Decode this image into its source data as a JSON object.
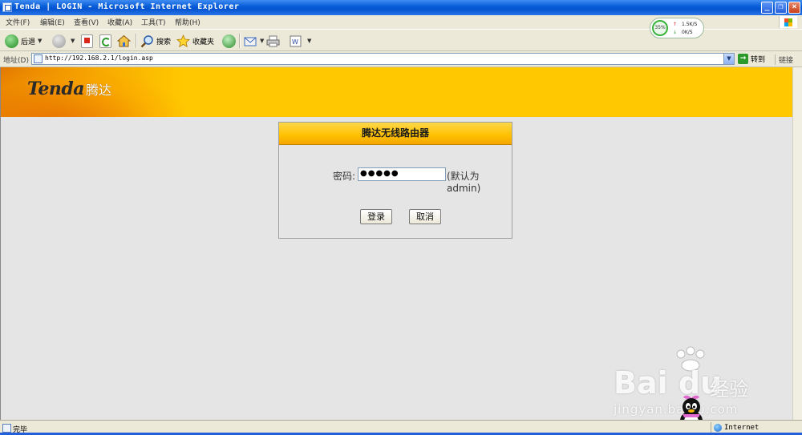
{
  "window": {
    "title": "Tenda | LOGIN - Microsoft Internet Explorer",
    "minimize": "_",
    "maximize": "❐",
    "close": "×"
  },
  "menubar": {
    "items": [
      {
        "label": "文件(F)"
      },
      {
        "label": "编辑(E)"
      },
      {
        "label": "查看(V)"
      },
      {
        "label": "收藏(A)"
      },
      {
        "label": "工具(T)"
      },
      {
        "label": "帮助(H)"
      }
    ]
  },
  "toolbar": {
    "back_label": "后退",
    "search_label": "搜索",
    "favorites_label": "收藏夹"
  },
  "speed_widget": {
    "cpu": "35%",
    "up": "1.5K/S",
    "down": "0K/S"
  },
  "addressbar": {
    "label": "地址(D)",
    "url": "http://192.168.2.1/login.asp",
    "go_label": "转到",
    "links_label": "链接"
  },
  "banner": {
    "logo_en": "Tenda",
    "logo_cn": "腾达"
  },
  "login": {
    "title": "腾达无线路由器",
    "password_label": "密码:",
    "password_value": "●●●●●",
    "password_hint": "(默认为admin)",
    "login_button": "登录",
    "cancel_button": "取消"
  },
  "watermark": {
    "brand": "Bai du",
    "brand_cn": "经验",
    "url": "jingyan.baidu.com"
  },
  "statusbar": {
    "status": "完毕",
    "zone": "Internet"
  },
  "colors": {
    "banner_yellow": "#ffc800",
    "banner_orange": "#e37800",
    "xp_blue": "#0a5fd8"
  }
}
